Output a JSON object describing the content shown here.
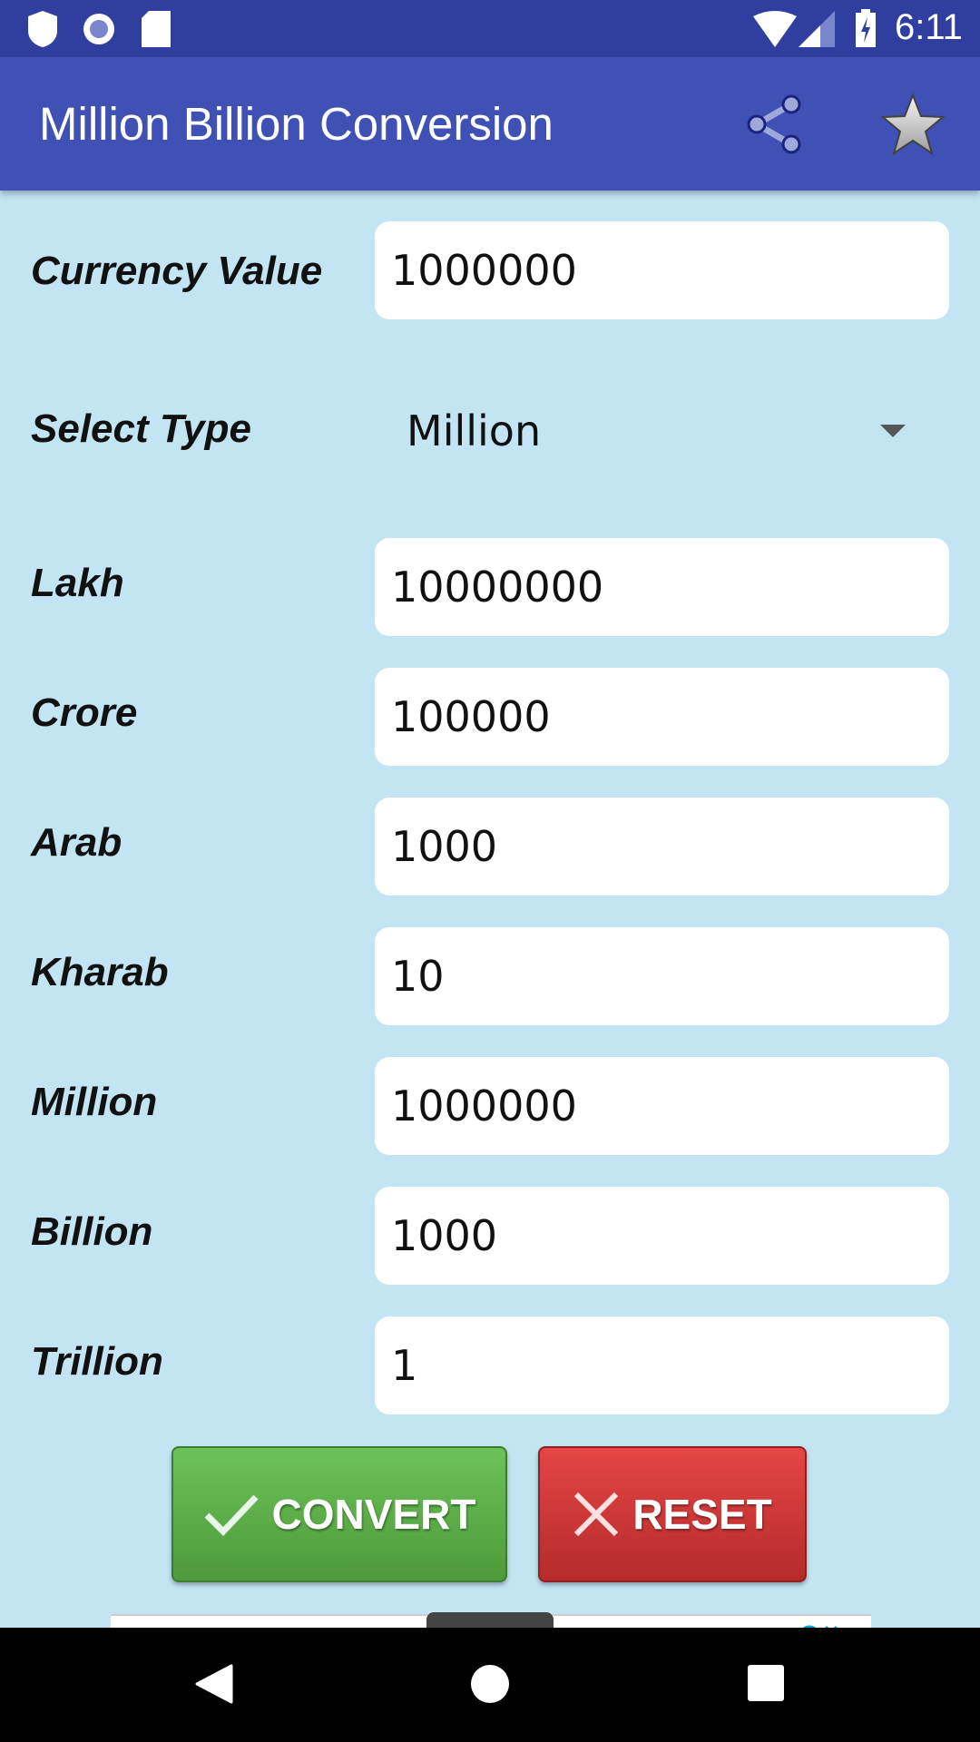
{
  "status_bar": {
    "time": "6:11"
  },
  "app_bar": {
    "title": "Million Billion Conversion",
    "icons": [
      "share-icon",
      "star-icon"
    ]
  },
  "form": {
    "currency_label": "Currency Value",
    "currency_value": "1000000",
    "select_label": "Select Type",
    "select_value": "Million",
    "rows": [
      {
        "label": "Lakh",
        "value": "10000000"
      },
      {
        "label": "Crore",
        "value": "100000"
      },
      {
        "label": "Arab",
        "value": "1000"
      },
      {
        "label": "Kharab",
        "value": "10"
      },
      {
        "label": "Million",
        "value": "1000000"
      },
      {
        "label": "Billion",
        "value": "1000"
      },
      {
        "label": "Trillion",
        "value": "1"
      }
    ]
  },
  "buttons": {
    "convert": "CONVERT",
    "reset": "RESET"
  },
  "colors": {
    "primary": "#3f51b5",
    "status": "#303f9f",
    "background": "#c2e4f3",
    "convert": "#5cab47",
    "reset": "#d23a3a"
  }
}
